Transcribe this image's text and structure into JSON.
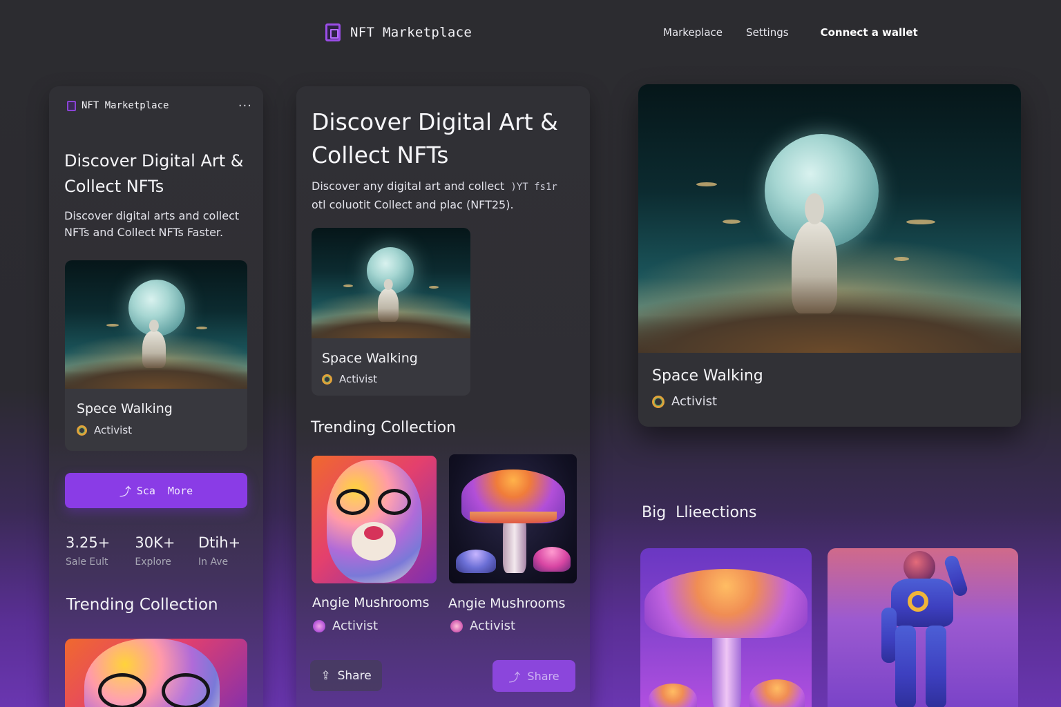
{
  "topnav": {
    "brand": "NFT Marketplace",
    "links": [
      "Markeplace",
      "Settings"
    ],
    "cta": "Connect a wallet",
    "accent": "#9b4de8"
  },
  "left_panel": {
    "brand": "NFT Marketplace",
    "menu_icon": "more-icon",
    "hero_title_line1": "Discover Digital Art &",
    "hero_title_line2": "Collect NFTs",
    "hero_desc_line1": "Discover digital arts and collect",
    "hero_desc_line2": "NFTs and Collect NFTs Faster.",
    "card": {
      "title": "Spece Walking",
      "sub": "Activist"
    },
    "cta_button": "Sca  More",
    "cta_color": "#8a3ce6",
    "stats": [
      {
        "value": "3.25+",
        "label": "Sale Eult"
      },
      {
        "value": "30K+",
        "label": "Explore"
      },
      {
        "value": "Dtih+",
        "label": "In Ave"
      }
    ],
    "trending_title": "Trending Collection"
  },
  "middle_panel": {
    "hero_title_line1": "Discover Digital Art &",
    "hero_title_line2": "Collect NFTs",
    "hero_desc_line1": "Discover any digital art and collect",
    "hero_desc_line1_mono": ")YT fs1r",
    "hero_desc_line2": "otl coluotit Collect and plac (NFT25).",
    "card": {
      "title": "Space Walking",
      "sub": "Activist"
    },
    "trending_title": "Trending Collection",
    "trending": [
      {
        "title": "Angie Mushrooms",
        "sub": "Activist"
      },
      {
        "title": "Angie Mushrooms",
        "sub": "Activist"
      }
    ],
    "share_left": "Share",
    "share_right": "Share"
  },
  "right_panel": {
    "card": {
      "title": "Space Walking",
      "sub": "Activist"
    },
    "collections_title": "Big  Llieections"
  }
}
